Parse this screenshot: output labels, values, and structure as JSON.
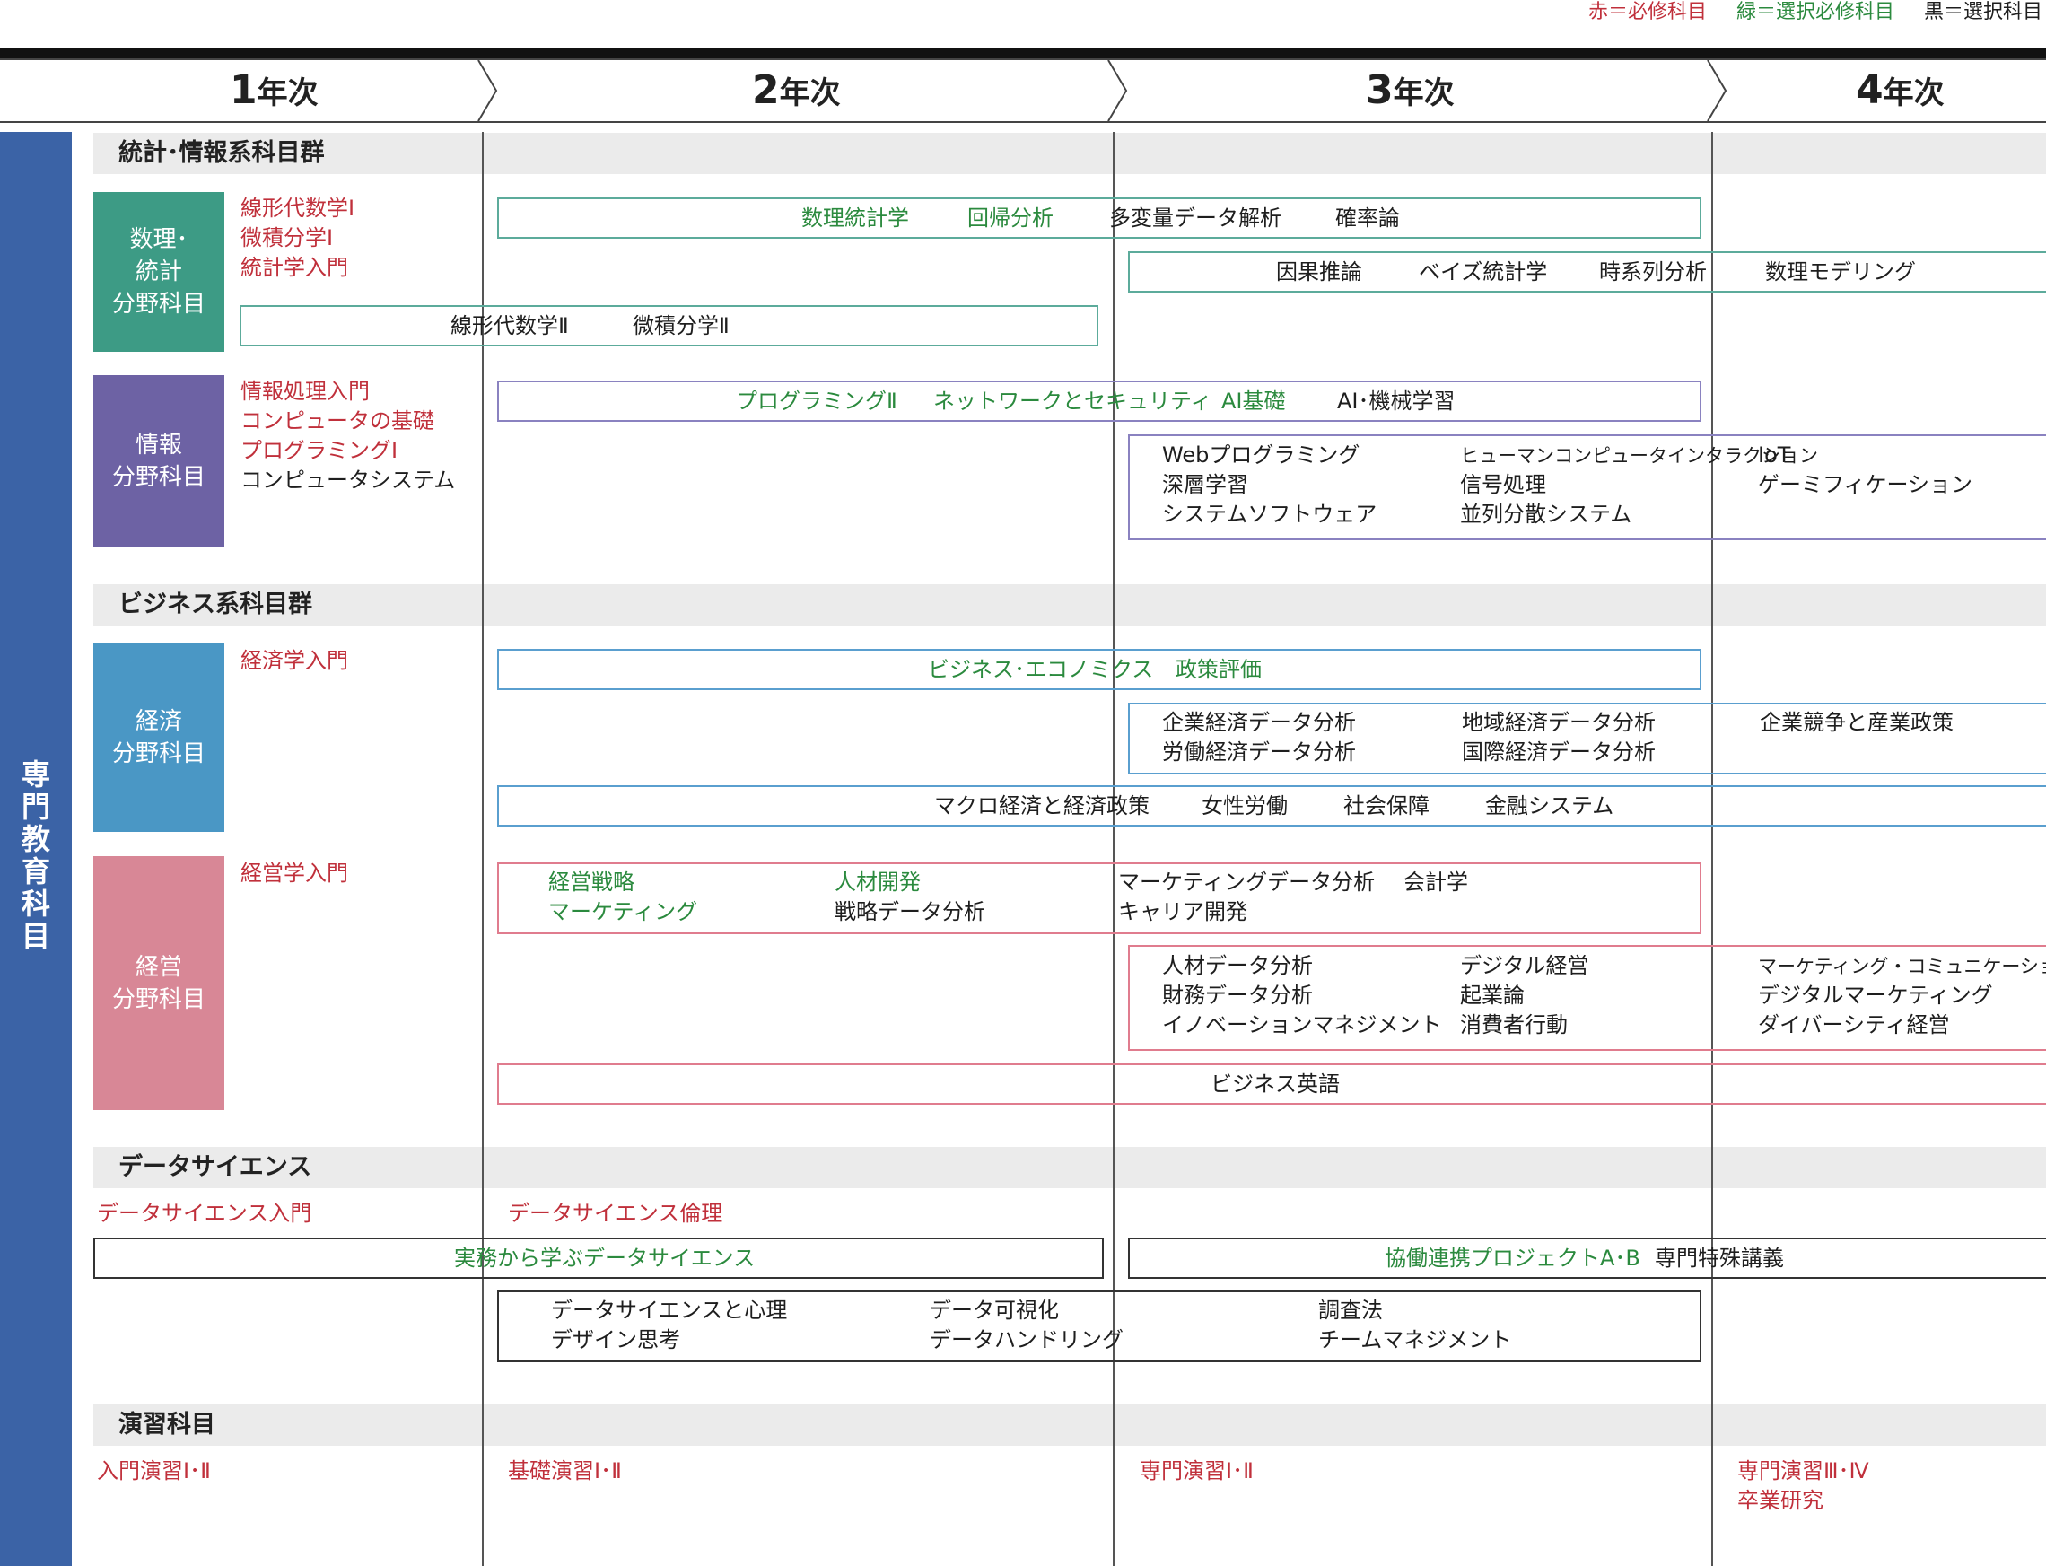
{
  "legend": {
    "red": "赤＝必修科目",
    "green": "緑＝選択必修科目",
    "black": "黒＝選択科目"
  },
  "colors": {
    "red": "#c0303b",
    "green": "#2b8a3e",
    "black": "#1e1e1e",
    "sidebar": "#3b63a6",
    "field_math": "#3d9b85",
    "field_info": "#6d62a4",
    "field_econ": "#4a97c5",
    "field_mgmt": "#d88796",
    "box_math": "#5cab9b",
    "box_info": "#8a82c0",
    "box_econ": "#5a9fcf",
    "box_mgmt": "#e07c8e"
  },
  "years": [
    {
      "n": "1",
      "suffix": "年次"
    },
    {
      "n": "2",
      "suffix": "年次"
    },
    {
      "n": "3",
      "suffix": "年次"
    },
    {
      "n": "4",
      "suffix": "年次"
    }
  ],
  "sidebar": {
    "chars": [
      "専",
      "門",
      "教",
      "育",
      "科",
      "目"
    ]
  },
  "groups": {
    "stat_info": "統計･情報系科目群",
    "business": "ビジネス系科目群",
    "datasci": "データサイエンス",
    "seminar": "演習科目"
  },
  "fields": {
    "math": [
      "数理･",
      "統計",
      "分野科目"
    ],
    "info": [
      "情報",
      "分野科目"
    ],
    "econ": [
      "経済",
      "分野科目"
    ],
    "mgmt": [
      "経営",
      "分野科目"
    ]
  },
  "courses": {
    "math_y1": [
      "線形代数学Ⅰ",
      "微積分学Ⅰ",
      "統計学入門"
    ],
    "math_b1": [
      "数理統計学",
      "回帰分析",
      "多変量データ解析",
      "確率論"
    ],
    "math_b2": [
      "因果推論",
      "ベイズ統計学",
      "時系列分析",
      "数理モデリング"
    ],
    "math_b3": [
      "線形代数学Ⅱ",
      "微積分学Ⅱ"
    ],
    "info_y1": [
      "情報処理入門",
      "コンピュータの基礎",
      "プログラミングⅠ",
      "コンピュータシステム"
    ],
    "info_b1": [
      "プログラミングⅡ",
      "ネットワークとセキュリティ",
      "AI基礎",
      "AI･機械学習"
    ],
    "info_b2": [
      "Webプログラミング",
      "深層学習",
      "システムソフトウェア",
      "ヒューマンコンピュータインタラクション",
      "信号処理",
      "並列分散システム",
      "IoT",
      "ゲーミフィケーション"
    ],
    "econ_y1": [
      "経済学入門"
    ],
    "econ_b1": [
      "ビジネス･エコノミクス",
      "政策評価"
    ],
    "econ_b2": [
      "企業経済データ分析",
      "労働経済データ分析",
      "地域経済データ分析",
      "国際経済データ分析",
      "企業競争と産業政策"
    ],
    "econ_b3": [
      "マクロ経済と経済政策",
      "女性労働",
      "社会保障",
      "金融システム"
    ],
    "mgmt_y1": [
      "経営学入門"
    ],
    "mgmt_b1": [
      "経営戦略",
      "マーケティング",
      "人材開発",
      "戦略データ分析",
      "マーケティングデータ分析",
      "キャリア開発",
      "会計学"
    ],
    "mgmt_b2": [
      "人材データ分析",
      "財務データ分析",
      "イノベーションマネジメント",
      "デジタル経営",
      "起業論",
      "消費者行動",
      "マーケティング・コミュニケーション",
      "デジタルマーケティング",
      "ダイバーシティ経営"
    ],
    "mgmt_b3": [
      "ビジネス英語"
    ],
    "ds_y1": [
      "データサイエンス入門"
    ],
    "ds_y2": [
      "データサイエンス倫理"
    ],
    "ds_b1": [
      "実務から学ぶデータサイエンス"
    ],
    "ds_b2": [
      "協働連携プロジェクトA･B",
      "専門特殊講義"
    ],
    "ds_b3": [
      "データサイエンスと心理",
      "デザイン思考",
      "データ可視化",
      "データハンドリング",
      "調査法",
      "チームマネジメント"
    ],
    "sem": [
      "入門演習Ⅰ･Ⅱ",
      "基礎演習Ⅰ･Ⅱ",
      "専門演習Ⅰ･Ⅱ",
      "専門演習Ⅲ･Ⅳ",
      "卒業研究"
    ]
  }
}
